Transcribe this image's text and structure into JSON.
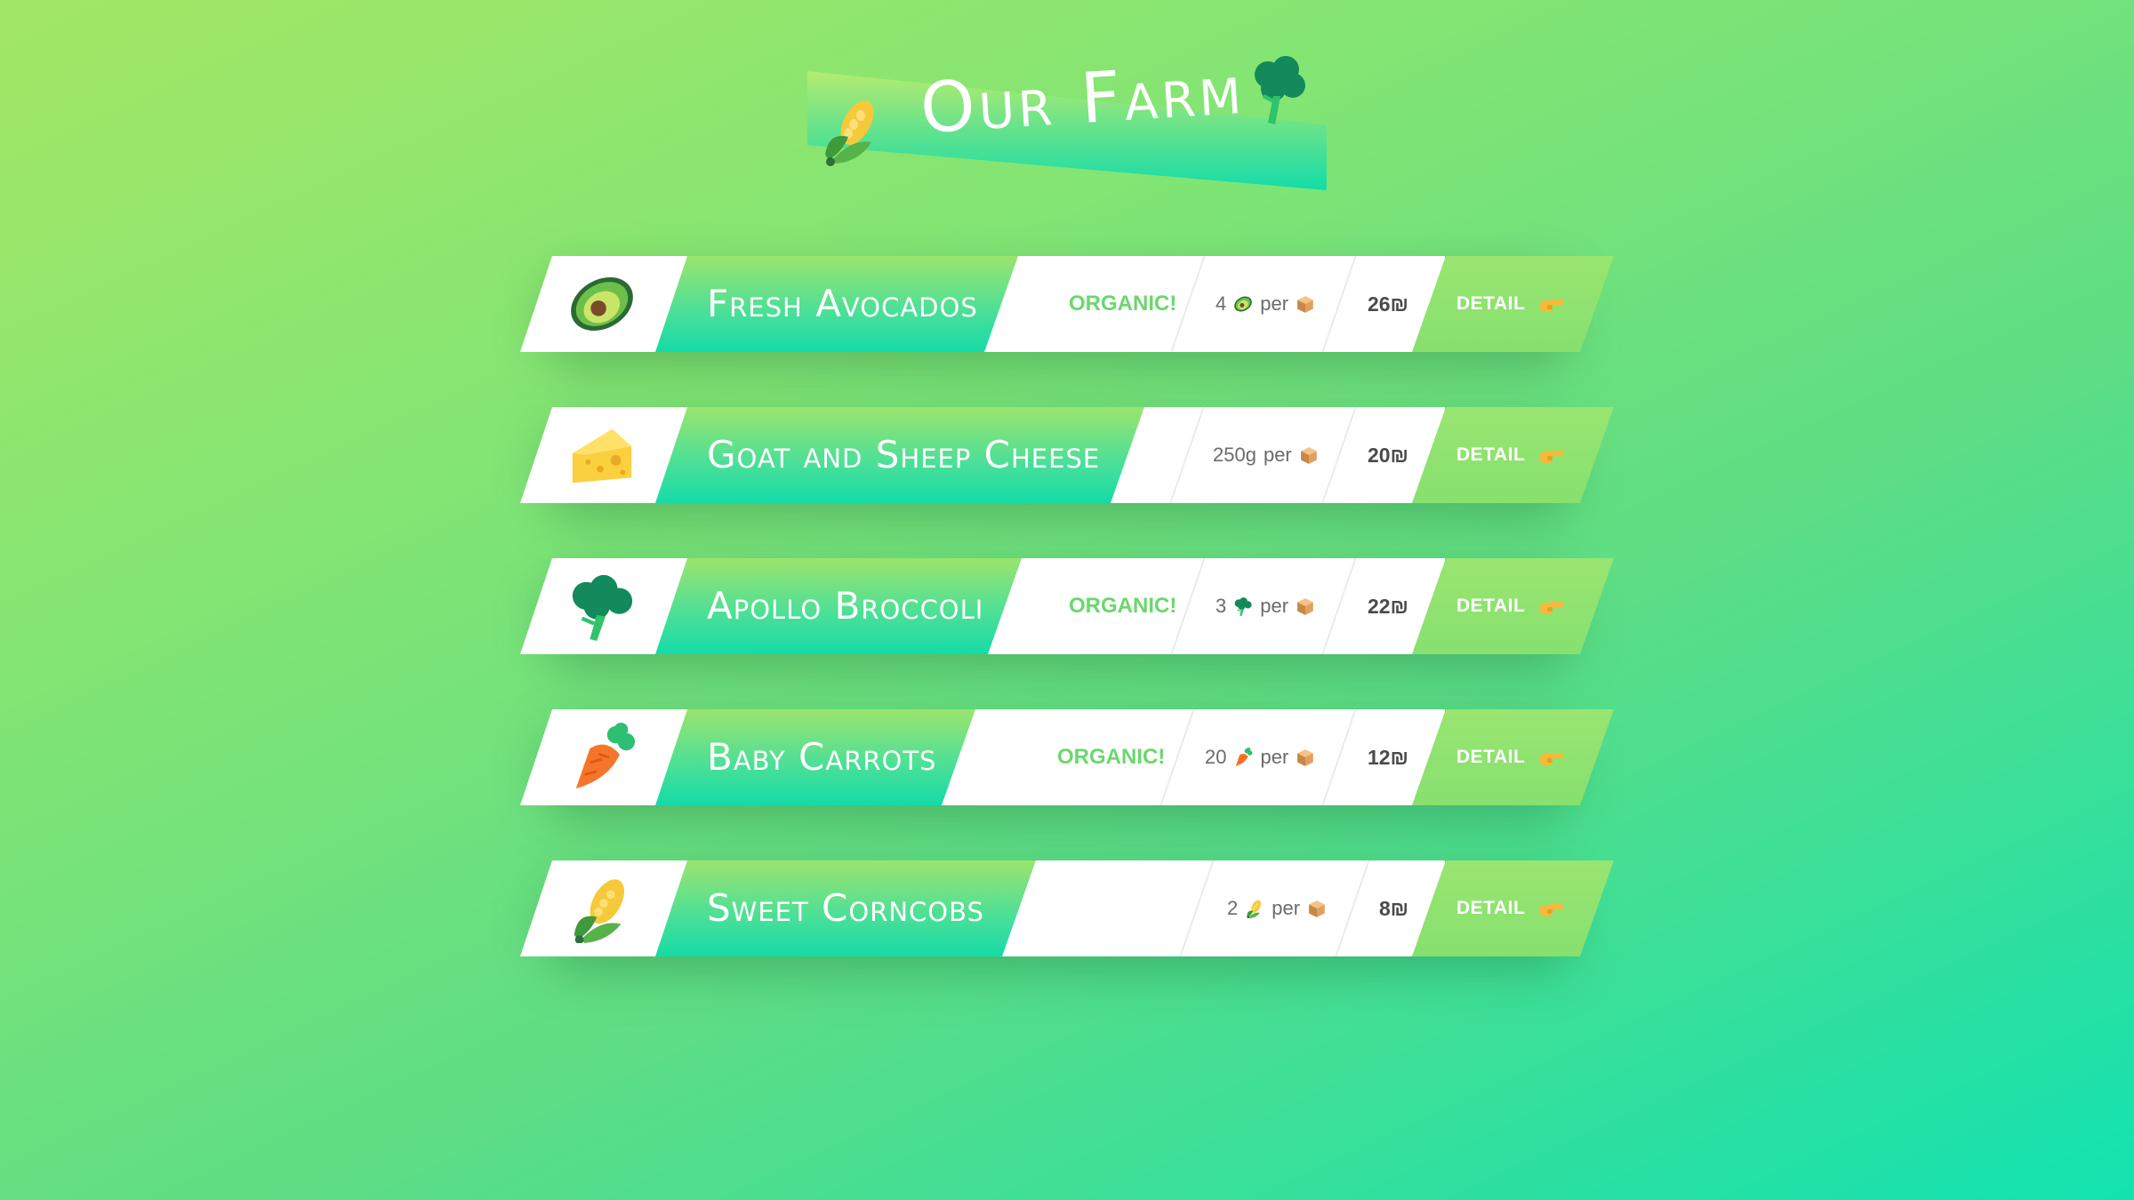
{
  "header": {
    "title": "Our Farm",
    "left_icon": "corn-icon",
    "right_icon": "broccoli-icon"
  },
  "colors": {
    "background_start": "#a3e665",
    "background_end": "#12e2b0",
    "organic_green": "#6bd76d",
    "detail_green": "#8fe370"
  },
  "products": [
    {
      "icon": "avocado-icon",
      "name": "Fresh Avocados",
      "organic": "ORGANIC!",
      "qty_amount": "4",
      "qty_icon": "avocado-icon",
      "qty_per": "per",
      "package_icon": "box-icon",
      "price": "26₪",
      "detail": "DETAIL",
      "detail_icon": "pointing-hand-icon"
    },
    {
      "icon": "cheese-icon",
      "name": "Goat and Sheep Cheese",
      "organic": "",
      "qty_amount": "250g",
      "qty_icon": "",
      "qty_per": "per",
      "package_icon": "box-icon",
      "price": "20₪",
      "detail": "DETAIL",
      "detail_icon": "pointing-hand-icon"
    },
    {
      "icon": "broccoli-icon",
      "name": "Apollo Broccoli",
      "organic": "ORGANIC!",
      "qty_amount": "3",
      "qty_icon": "broccoli-icon",
      "qty_per": "per",
      "package_icon": "box-icon",
      "price": "22₪",
      "detail": "DETAIL",
      "detail_icon": "pointing-hand-icon"
    },
    {
      "icon": "carrot-icon",
      "name": "Baby Carrots",
      "organic": "ORGANIC!",
      "qty_amount": "20",
      "qty_icon": "carrot-icon",
      "qty_per": "per",
      "package_icon": "box-icon",
      "price": "12₪",
      "detail": "DETAIL",
      "detail_icon": "pointing-hand-icon"
    },
    {
      "icon": "corn-icon",
      "name": "Sweet Corncobs",
      "organic": "",
      "qty_amount": "2",
      "qty_icon": "corn-icon",
      "qty_per": "per",
      "package_icon": "box-icon",
      "price": "8₪",
      "detail": "DETAIL",
      "detail_icon": "pointing-hand-icon"
    }
  ]
}
